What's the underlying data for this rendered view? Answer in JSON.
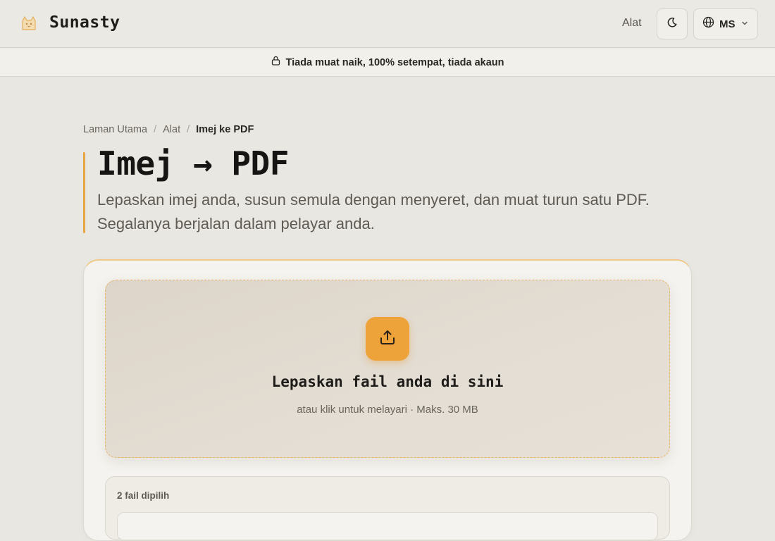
{
  "header": {
    "brand": "Sunasty",
    "nav_tools": "Alat",
    "lang_label": "MS"
  },
  "banner": {
    "text": "Tiada muat naik, 100% setempat, tiada akaun"
  },
  "breadcrumb": {
    "home": "Laman Utama",
    "tools": "Alat",
    "current": "Imej ke PDF"
  },
  "page": {
    "title": "Imej → PDF",
    "subtitle": "Lepaskan imej anda, susun semula dengan menyeret, dan muat turun satu PDF. Segalanya berjalan dalam pelayar anda."
  },
  "dropzone": {
    "title": "Lepaskan fail anda di sini",
    "hint": "atau klik untuk melayari · Maks. 30 MB"
  },
  "files": {
    "count_label": "2 fail dipilih"
  },
  "icons": {
    "logo": "cat-logo-icon",
    "theme": "moon-icon",
    "language": "globe-icon",
    "dropdown": "chevron-down-icon",
    "banner": "lock-icon",
    "upload": "upload-icon"
  },
  "colors": {
    "accent": "#eea33a",
    "background": "#e9e7e1",
    "text": "#1f1d1a"
  }
}
